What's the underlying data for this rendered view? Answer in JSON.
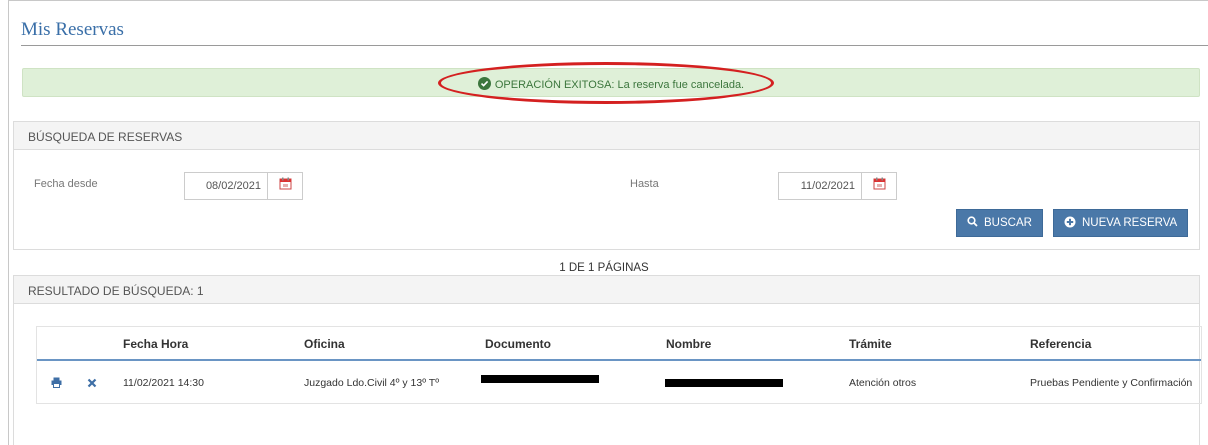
{
  "page": {
    "title": "Mis Reservas"
  },
  "alert": {
    "text": "OPERACIÓN EXITOSA: La reserva fue cancelada.",
    "color": "#3c763d"
  },
  "search": {
    "title": "BÚSQUEDA DE RESERVAS",
    "from_label": "Fecha desde",
    "from_value": "08/02/2021",
    "to_label": "Hasta",
    "to_value": "11/02/2021",
    "search_button": "BUSCAR",
    "new_button": "NUEVA RESERVA"
  },
  "pagination": {
    "text": "1 DE 1 PÁGINAS"
  },
  "results": {
    "title": "RESULTADO DE BÚSQUEDA: 1",
    "columns": [
      "Fecha Hora",
      "Oficina",
      "Documento",
      "Nombre",
      "Trámite",
      "Referencia"
    ],
    "rows": [
      {
        "fecha_hora": "11/02/2021 14:30",
        "oficina": "Juzgado Ldo.Civil 4º y 13º Tº",
        "tramite": "Atención otros",
        "referencia": "Pruebas Pendiente y Confirmación"
      }
    ]
  },
  "icons": {
    "alert": "check-circle-icon",
    "calendar": "calendar-icon",
    "search": "search-icon",
    "add": "plus-circle-icon",
    "print": "print-icon",
    "cancel": "close-icon"
  },
  "colors": {
    "accent": "#4a78a8",
    "title": "#3a6fa8",
    "alert_bg": "#dff0d8",
    "annotation": "#d42020"
  }
}
